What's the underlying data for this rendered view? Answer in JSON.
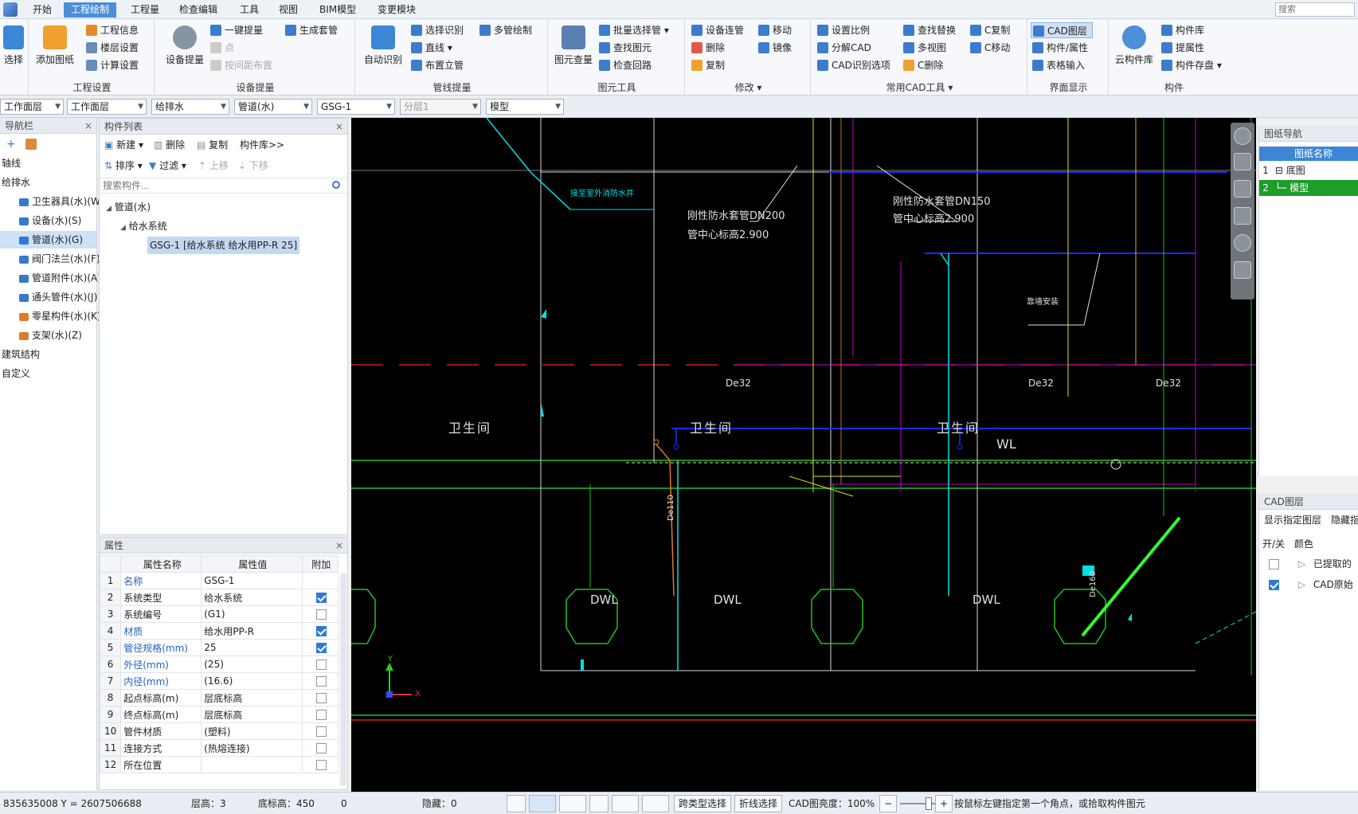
{
  "menu": {
    "tabs": [
      "开始",
      "工程绘制",
      "工程量",
      "检查编辑",
      "工具",
      "视图",
      "BIM模型",
      "变更模块"
    ],
    "active_tab": "工程绘制",
    "search_placeholder": "搜索"
  },
  "ribbon": {
    "select_label": "选择",
    "add_drawing": "添加图纸",
    "project_info": "工程信息",
    "floor_settings": "楼层设置",
    "calc_settings": "计算设置",
    "group_project": "工程设置",
    "equipment_extract": "设备提量",
    "one_click_extract": "一键提量",
    "point": "点",
    "by_spacing": "按间距布置",
    "gen_sleeve": "生成套管",
    "group_equipment": "设备提量",
    "auto_identify": "自动识别",
    "select_identify": "选择识别",
    "straight_line": "直线",
    "arrange_riser": "布置立管",
    "multi_pipe_draw": "多管绘制",
    "group_pipe": "管线提量",
    "view_element": "图元查量",
    "batch_select_pipe": "批量选择管",
    "find_element": "查找图元",
    "check_loop": "检查回路",
    "group_element_tools": "图元工具",
    "equip_connect_pipe": "设备连管",
    "move": "移动",
    "delete": "删除",
    "mirror": "镜像",
    "copy": "复制",
    "group_modify": "修改",
    "set_scale": "设置比例",
    "find_replace": "查找替换",
    "c_copy": "C复制",
    "split_cad": "分解CAD",
    "multi_view": "多视图",
    "c_move": "C移动",
    "cad_identify_options": "CAD识别选项",
    "c_delete": "C删除",
    "group_cad_tools": "常用CAD工具",
    "cad_layer": "CAD图层",
    "component_property": "构件/属性",
    "table_input": "表格输入",
    "group_ui_display": "界面显示",
    "cloud_library": "云构件库",
    "component_library": "构件库",
    "extract_property": "提属性",
    "component_save": "构件存盘",
    "group_component": "构件"
  },
  "combos": [
    "工作面层",
    "工作面层",
    "给排水",
    "管道(水)",
    "GSG-1",
    "分层1",
    "模型"
  ],
  "nav": {
    "title": "导航栏",
    "items": [
      {
        "label": "轴线",
        "indent": 0
      },
      {
        "label": "给排水",
        "indent": 0
      },
      {
        "label": "卫生器具(水)(W)",
        "indent": 1,
        "color": "#3a78c8"
      },
      {
        "label": "设备(水)(S)",
        "indent": 1,
        "color": "#3a78c8"
      },
      {
        "label": "管道(水)(G)",
        "indent": 1,
        "color": "#2e7ad6",
        "selected": true
      },
      {
        "label": "阀门法兰(水)(F)",
        "indent": 1,
        "color": "#3a78c8"
      },
      {
        "label": "管道附件(水)(A)",
        "indent": 1,
        "color": "#3a78c8"
      },
      {
        "label": "通头管件(水)(J)",
        "indent": 1,
        "color": "#3a78c8"
      },
      {
        "label": "零星构件(水)(K)",
        "indent": 1,
        "color": "#e07a2a"
      },
      {
        "label": "支架(水)(Z)",
        "indent": 1,
        "color": "#e07a2a"
      },
      {
        "label": "建筑结构",
        "indent": 0
      },
      {
        "label": "自定义",
        "indent": 0
      }
    ]
  },
  "complist": {
    "title": "构件列表",
    "new_btn": "新建",
    "delete_btn": "删除",
    "copy_btn": "复制",
    "library_btn": "构件库>>",
    "sort_btn": "排序",
    "filter_btn": "过滤",
    "up_btn": "上移",
    "down_btn": "下移",
    "search_placeholder": "搜索构件...",
    "tree_root": "管道(水)",
    "tree_group": "给水系统",
    "tree_leaf": "GSG-1 [给水系统 给水用PP-R 25]"
  },
  "props": {
    "title": "属性",
    "col_name": "属性名称",
    "col_value": "属性值",
    "col_extra": "附加",
    "rows": [
      {
        "n": "1",
        "name": "名称",
        "value": "GSG-1",
        "blue": true,
        "cb": null
      },
      {
        "n": "2",
        "name": "系统类型",
        "value": "给水系统",
        "blue": false,
        "cb": true
      },
      {
        "n": "3",
        "name": "系统编号",
        "value": "(G1)",
        "blue": false,
        "cb": false
      },
      {
        "n": "4",
        "name": "材质",
        "value": "给水用PP-R",
        "blue": true,
        "cb": true
      },
      {
        "n": "5",
        "name": "管径规格(mm)",
        "value": "25",
        "blue": true,
        "cb": true
      },
      {
        "n": "6",
        "name": "外径(mm)",
        "value": "(25)",
        "blue": true,
        "cb": false
      },
      {
        "n": "7",
        "name": "内径(mm)",
        "value": "(16.6)",
        "blue": true,
        "cb": false
      },
      {
        "n": "8",
        "name": "起点标高(m)",
        "value": "层底标高",
        "blue": false,
        "cb": false
      },
      {
        "n": "9",
        "name": "终点标高(m)",
        "value": "层底标高",
        "blue": false,
        "cb": false
      },
      {
        "n": "10",
        "name": "管件材质",
        "value": "(塑料)",
        "blue": false,
        "cb": false
      },
      {
        "n": "11",
        "name": "连接方式",
        "value": "(热熔连接)",
        "blue": false,
        "cb": false
      },
      {
        "n": "12",
        "name": "所在位置",
        "value": "",
        "blue": false,
        "cb": false
      }
    ]
  },
  "drawing": {
    "label_dn200": "刚性防水套管DN200",
    "label_dn200_h": "管中心标高2.900",
    "label_dn150": "刚性防水套管DN150",
    "label_dn150_h": "管中心标高2.900",
    "label_riser": "接至室外消防水井",
    "label_install": "靠墙安装",
    "de32": "De32",
    "de110": "De110",
    "de160": "De160",
    "room1": "卫生间",
    "room2": "卫生间",
    "room3": "卫生间",
    "wl": "WL",
    "dwl": "DWL",
    "axis_x": "X",
    "axis_y": "Y"
  },
  "rightnav": {
    "title": "图纸导航",
    "col": "图纸名称",
    "rows": [
      {
        "n": "1",
        "label": "底图"
      },
      {
        "n": "2",
        "label": "模型",
        "selected": true
      }
    ]
  },
  "cadlayer": {
    "title": "CAD图层",
    "show_specified": "显示指定图层",
    "hide_specified": "隐藏指定",
    "col_onoff": "开/关",
    "col_color": "颜色",
    "rows": [
      {
        "label": "已提取的",
        "on": false
      },
      {
        "label": "CAD原始",
        "on": true
      }
    ]
  },
  "status": {
    "coords": "835635008 Y = 2607506688",
    "floor_height": "层高：3",
    "bottom_elev": "底标高：450",
    "zero": "0",
    "hidden": "隐藏：0",
    "type_select": "跨类型选择",
    "polyline_select": "折线选择",
    "cad_brightness": "CAD图亮度：100%",
    "hint": "按鼠标左键指定第一个角点，或拾取构件图元"
  },
  "colors": {
    "accent": "#4a8fd8",
    "canvas_bg": "#000000",
    "selected_green": "#1f9c2a"
  }
}
